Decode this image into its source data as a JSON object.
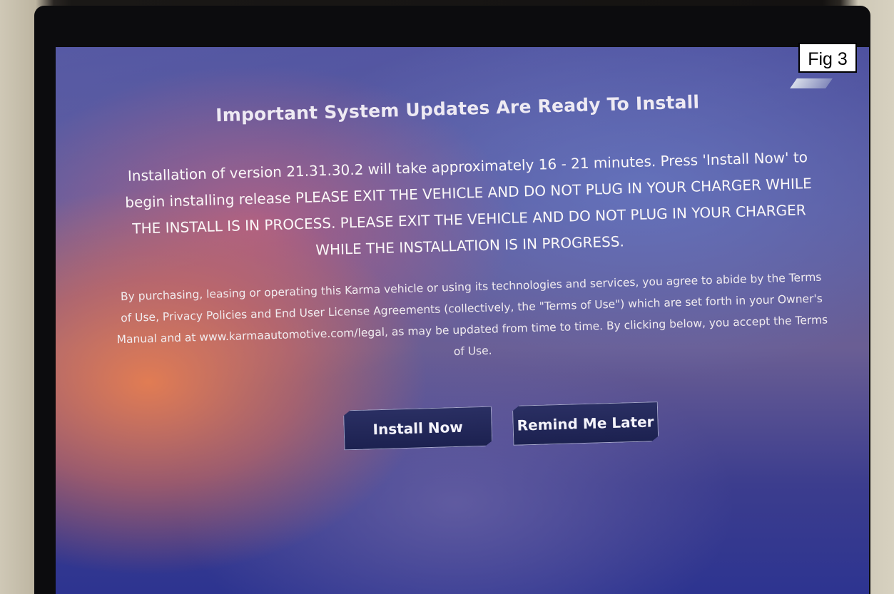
{
  "figure_label": "Fig 3",
  "dialog": {
    "title": "Important System Updates Are Ready To Install",
    "message": "Installation of version 21.31.30.2 will take approximately 16 - 21 minutes. Press 'Install Now' to begin installing release PLEASE EXIT THE VEHICLE AND DO NOT PLUG IN YOUR CHARGER WHILE THE INSTALL IS IN PROCESS. PLEASE EXIT THE VEHICLE AND DO NOT PLUG IN YOUR CHARGER WHILE THE INSTALLATION IS IN PROGRESS.",
    "legal": "By purchasing, leasing or operating this Karma vehicle or using its technologies and services, you agree to abide by the Terms of Use, Privacy Policies and End User License Agreements (collectively, the \"Terms of Use\") which are set forth in your Owner's Manual and at www.karmaautomotive.com/legal, as may be updated from time to time.  By clicking below, you accept the Terms of Use.",
    "buttons": {
      "install_now": "Install Now",
      "remind_later": "Remind Me Later"
    }
  }
}
